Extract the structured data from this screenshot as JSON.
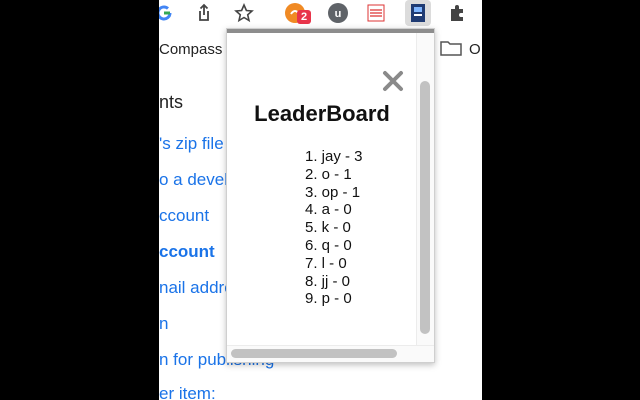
{
  "toolbar": {
    "icons": [
      "google-logo-icon",
      "share-icon",
      "star-bookmark-icon",
      "extension-1-icon",
      "extension-2-icon",
      "extension-3-icon",
      "extension-leaderboard-icon",
      "puzzle-extensions-icon"
    ],
    "extension_badge": "2"
  },
  "bookmarks": {
    "compass_label": "Compass",
    "other_label": "O"
  },
  "page": {
    "heading": "nts",
    "links": [
      "'s zip file",
      "o a devel",
      "ccount",
      "ccount",
      "nail addre",
      "n",
      "n for publishing",
      "er item:"
    ]
  },
  "popup": {
    "title": "LeaderBoard",
    "entries": [
      "1. jay - 3",
      "2. o - 1",
      "3. op - 1",
      "4. a - 0",
      "5. k - 0",
      "6. q - 0",
      "7. l - 0",
      "8. jj - 0",
      "9. p - 0"
    ],
    "close_icon": "close-icon"
  },
  "colors": {
    "link": "#1a73e8",
    "badge": "#e8344a",
    "background": "#000000"
  }
}
